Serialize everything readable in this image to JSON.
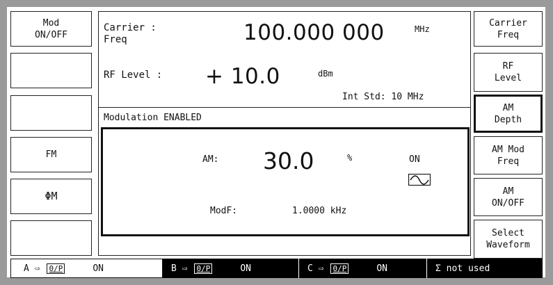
{
  "left_softkeys": [
    {
      "label": "Mod\nON/OFF"
    },
    {
      "label": ""
    },
    {
      "label": ""
    },
    {
      "label": "FM"
    },
    {
      "label": "ΦM"
    },
    {
      "label": ""
    }
  ],
  "right_softkeys": [
    {
      "label": "Carrier\nFreq"
    },
    {
      "label": "RF\nLevel"
    },
    {
      "label": "AM\nDepth",
      "selected": true
    },
    {
      "label": "AM Mod\nFreq"
    },
    {
      "label": "AM\nON/OFF"
    },
    {
      "label": "Select\nWaveform"
    }
  ],
  "carrier": {
    "label": "Carrier :\nFreq",
    "value": "100.000 000",
    "unit": "MHz"
  },
  "rf_level": {
    "label": "RF Level :",
    "value": "+ 10.0",
    "unit": "dBm"
  },
  "int_std": "Int Std:  10 MHz",
  "modulation_status": "Modulation ENABLED",
  "am": {
    "label": "AM:",
    "value": "30.0",
    "unit": "%",
    "state": "ON",
    "modf_label": "ModF:",
    "modf_value": "1.0000 kHz",
    "waveform_icon": "sine-wave-icon"
  },
  "status_bar": {
    "a_prefix": "A ⇨",
    "a_box": "0/P",
    "a_state": "ON",
    "b_prefix": "B ⇨",
    "b_box": "0/P",
    "b_state": "ON",
    "c_prefix": "C ⇨",
    "c_box": "0/P",
    "c_state": "ON",
    "sigma": "Σ not used"
  },
  "colors": {
    "bezel": "#9a9a9a",
    "screen": "#ffffff",
    "ink": "#111111"
  }
}
